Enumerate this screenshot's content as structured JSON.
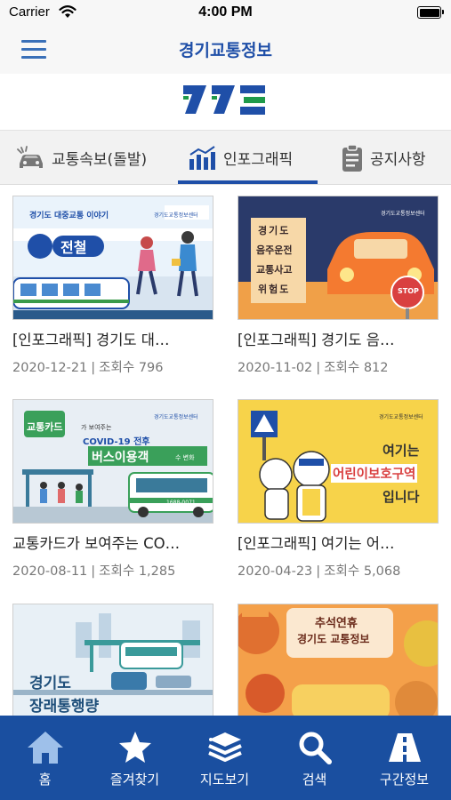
{
  "status_bar": {
    "carrier": "Carrier",
    "time": "4:00 PM"
  },
  "nav": {
    "title": "경기교통정보",
    "menu_icon": "hamburger-menu-icon"
  },
  "logo": {
    "icon": "ggtis-logo",
    "colors": [
      "#1f4fa8",
      "#1f9a4a"
    ]
  },
  "tabs": [
    {
      "label": "교통속보(돌발)",
      "icon": "car-accident-icon",
      "active": false
    },
    {
      "label": "인포그래픽",
      "icon": "bar-chart-icon",
      "active": true
    },
    {
      "label": "공지사항",
      "icon": "clipboard-icon",
      "active": false
    }
  ],
  "cards": [
    {
      "title": "[인포그래픽] 경기도 대…",
      "date": "2020-12-21",
      "views_label": "조회수",
      "views": "796",
      "thumb": {
        "headline": "경기도 대중교통 이야기",
        "badge": "전철",
        "sub": "경기도교통정보센터"
      }
    },
    {
      "title": "[인포그래픽] 경기도 음…",
      "date": "2020-11-02",
      "views_label": "조회수",
      "views": "812",
      "thumb": {
        "lines": [
          "경기도",
          "음주운전",
          "교통사고",
          "위험도"
        ],
        "sign": "STOP",
        "sub": "경기도교통정보센터"
      }
    },
    {
      "title": "교통카드가 보여주는 CO…",
      "date": "2020-08-11",
      "views_label": "조회수",
      "views": "1,285",
      "thumb": {
        "card_text": "교통카드",
        "line1": "가 보여주는",
        "line2": "COVID-19 전후",
        "line3": "버스이용객",
        "line3_suffix": "수 변화",
        "phone": "1688-0071",
        "sub": "경기도교통정보센터"
      }
    },
    {
      "title": "[인포그래픽] 여기는 어…",
      "date": "2020-04-23",
      "views_label": "조회수",
      "views": "5,068",
      "thumb": {
        "line1": "여기는",
        "line2": "어린이보호구역",
        "line3": "입니다",
        "sub": "경기도교통정보센터"
      }
    },
    {
      "title": "",
      "date": "",
      "views_label": "",
      "views": "",
      "thumb": {
        "line1": "경기도",
        "line2": "장래통행량"
      }
    },
    {
      "title": "",
      "date": "",
      "views_label": "",
      "views": "",
      "thumb": {
        "line1": "추석연휴",
        "line2": "경기도 교통정보"
      }
    }
  ],
  "bottom_nav": [
    {
      "label": "홈",
      "icon": "home-icon"
    },
    {
      "label": "즐겨찾기",
      "icon": "star-icon"
    },
    {
      "label": "지도보기",
      "icon": "layers-icon"
    },
    {
      "label": "검색",
      "icon": "search-icon"
    },
    {
      "label": "구간정보",
      "icon": "road-icon"
    }
  ],
  "colors": {
    "brand_blue": "#1f4fa8",
    "bottom_bar": "#1a4fa0",
    "logo_green": "#1f9a4a"
  }
}
